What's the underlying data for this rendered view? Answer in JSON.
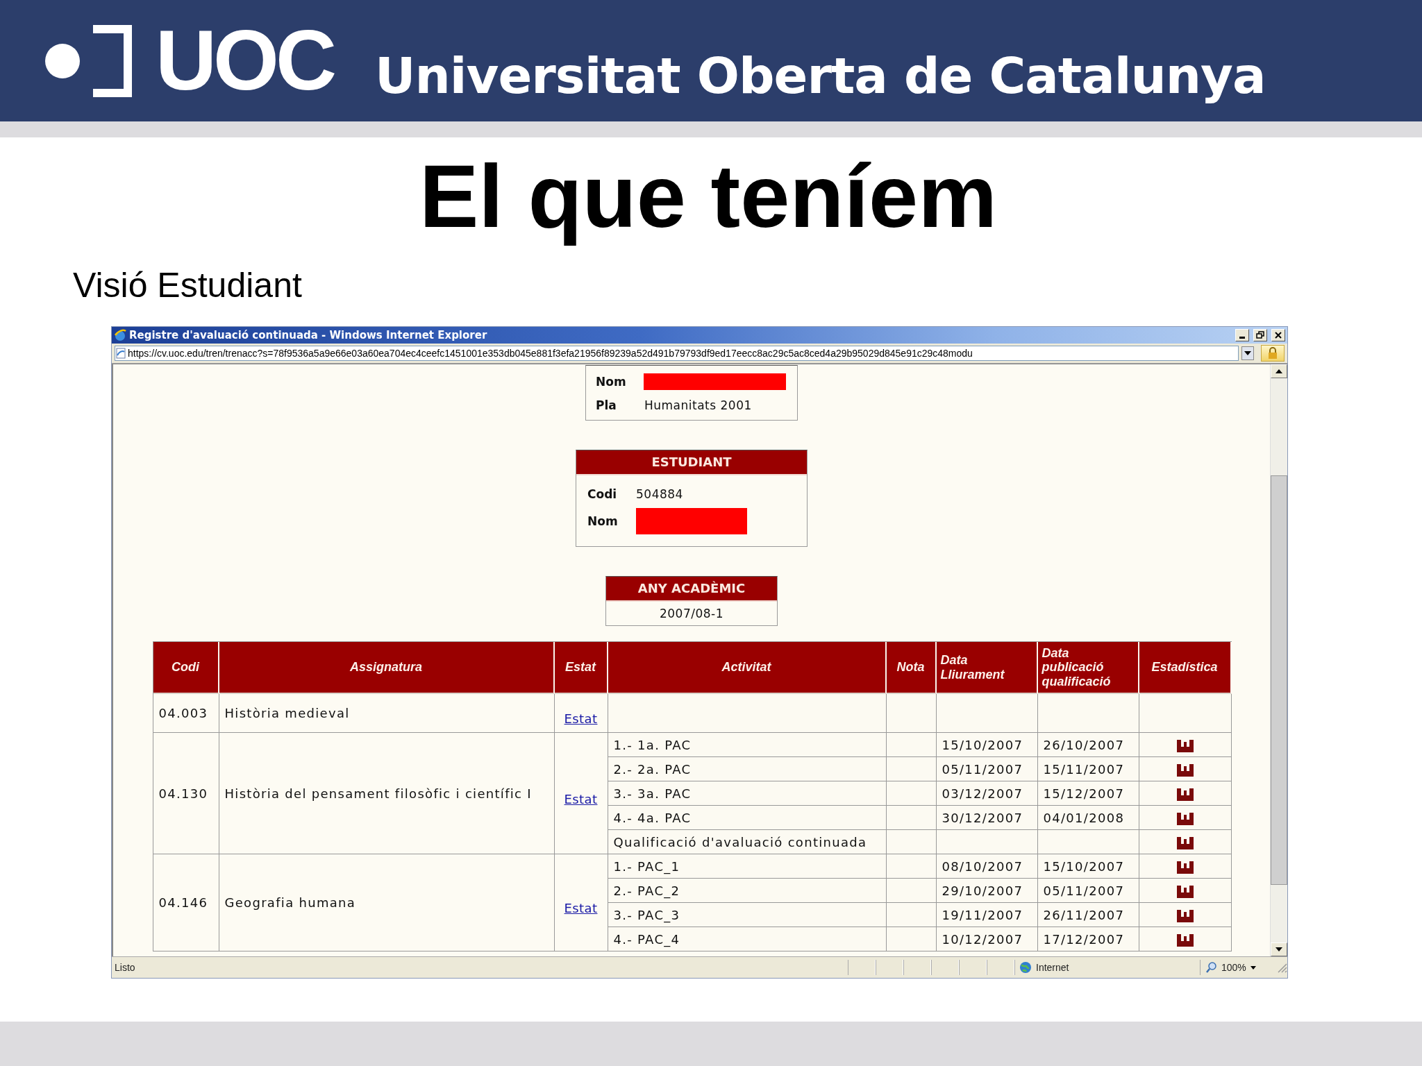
{
  "slide": {
    "logo_text": "UOC",
    "institution": "Universitat Oberta de Catalunya",
    "title": "El que teníem",
    "subtitle": "Visió Estudiant"
  },
  "browser": {
    "window_title": "Registre d'avaluació continuada - Windows Internet Explorer",
    "url": "https://cv.uoc.edu/tren/trenacc?s=78f9536a5a9e66e03a60ea704ec4ceefc1451001e353db045e881f3efa21956f89239a52d491b79793df9ed17eecc8ac29c5ac8ced4a29b95029d845e91c29c48modu",
    "status_text": "Listo",
    "zone": "Internet",
    "zoom": "100%"
  },
  "plan_box": {
    "rows": [
      {
        "label": "Nom",
        "kind": "redacted"
      },
      {
        "label": "Pla",
        "kind": "text",
        "value": "Humanitats 2001"
      }
    ]
  },
  "student_box": {
    "header": "ESTUDIANT",
    "rows": [
      {
        "label": "Codi",
        "kind": "text",
        "value": "504884"
      },
      {
        "label": "Nom",
        "kind": "redacted"
      }
    ]
  },
  "year_box": {
    "header": "ANY ACADÈMIC",
    "value": "2007/08-1"
  },
  "table": {
    "columns": [
      "Codi",
      "Assignatura",
      "Estat",
      "Activitat",
      "Nota",
      "Data Lliurament",
      "Data publicació qualificació",
      "Estadística"
    ],
    "rows": [
      {
        "code": "04.003",
        "name": "Història medieval",
        "status_link": "Estat",
        "activities": []
      },
      {
        "code": "04.130",
        "name": "Història del pensament filosòfic i científic I",
        "status_link": "Estat",
        "activities": [
          {
            "name": "1.- 1a. PAC",
            "delivery": "15/10/2007",
            "publication": "26/10/2007"
          },
          {
            "name": "2.- 2a. PAC",
            "delivery": "05/11/2007",
            "publication": "15/11/2007"
          },
          {
            "name": "3.- 3a. PAC",
            "delivery": "03/12/2007",
            "publication": "15/12/2007"
          },
          {
            "name": "4.- 4a. PAC",
            "delivery": "30/12/2007",
            "publication": "04/01/2008"
          },
          {
            "name": "Qualificació d'avaluació continuada"
          }
        ]
      },
      {
        "code": "04.146",
        "name": "Geografia humana",
        "status_link": "Estat",
        "activities": [
          {
            "name": "1.- PAC_1",
            "delivery": "08/10/2007",
            "publication": "15/10/2007"
          },
          {
            "name": "2.- PAC_2",
            "delivery": "29/10/2007",
            "publication": "05/11/2007"
          },
          {
            "name": "3.- PAC_3",
            "delivery": "19/11/2007",
            "publication": "26/11/2007"
          },
          {
            "name": "4.- PAC_4",
            "delivery": "10/12/2007",
            "publication": "17/12/2007"
          }
        ]
      }
    ]
  }
}
